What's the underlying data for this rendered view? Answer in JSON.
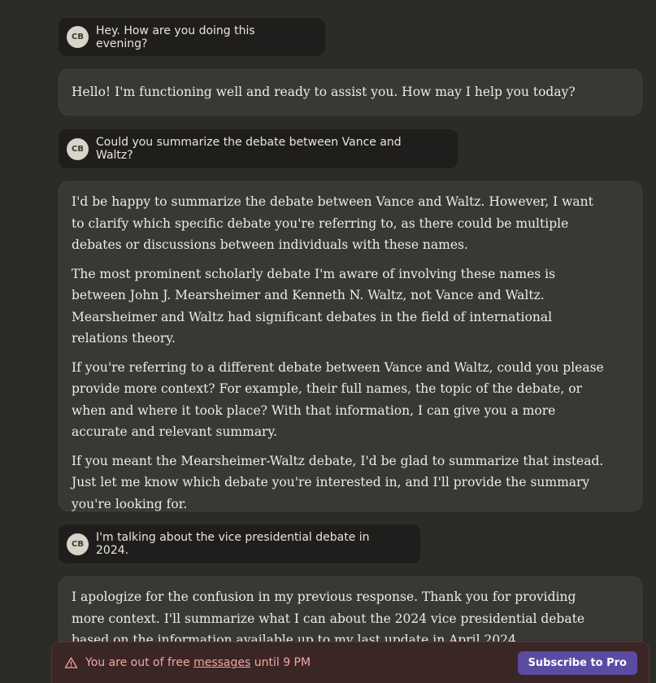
{
  "conversation": [
    {
      "role": "user",
      "avatar": "CB",
      "text": "Hey. How are you doing this evening?"
    },
    {
      "role": "assistant",
      "paragraphs": [
        "Hello! I'm functioning well and ready to assist you. How may I help you today?"
      ]
    },
    {
      "role": "user",
      "avatar": "CB",
      "text": "Could you summarize the debate between Vance and Waltz?"
    },
    {
      "role": "assistant",
      "paragraphs": [
        "I'd be happy to summarize the debate between Vance and Waltz. However, I want to clarify which specific debate you're referring to, as there could be multiple debates or discussions between individuals with these names.",
        "The most prominent scholarly debate I'm aware of involving these names is between John J. Mearsheimer and Kenneth N. Waltz, not Vance and Waltz. Mearsheimer and Waltz had significant debates in the field of international relations theory.",
        "If you're referring to a different debate between Vance and Waltz, could you please provide more context? For example, their full names, the topic of the debate, or when and where it took place? With that information, I can give you a more accurate and relevant summary.",
        "If you meant the Mearsheimer-Waltz debate, I'd be glad to summarize that instead. Just let me know which debate you're interested in, and I'll provide the summary you're looking for."
      ]
    },
    {
      "role": "user",
      "avatar": "CB",
      "text": "I'm talking about the vice presidential debate in 2024."
    },
    {
      "role": "assistant",
      "paragraphs": [
        "I apologize for the confusion in my previous response. Thank you for providing more context. I'll summarize what I can about the 2024 vice presidential debate based on the information available up to my last update in April 2024."
      ]
    }
  ],
  "banner": {
    "text_before": "You are out of free ",
    "link": "messages",
    "text_after": " until 9 PM",
    "button": "Subscribe to Pro",
    "icon": "warning-icon"
  },
  "colors": {
    "background": "#2c2b28",
    "user_bubble": "#1f1e1c",
    "assistant_bubble": "#393835",
    "banner_bg": "#3b2626",
    "banner_text": "#f0a8a0",
    "button": "#5b4ba3"
  }
}
